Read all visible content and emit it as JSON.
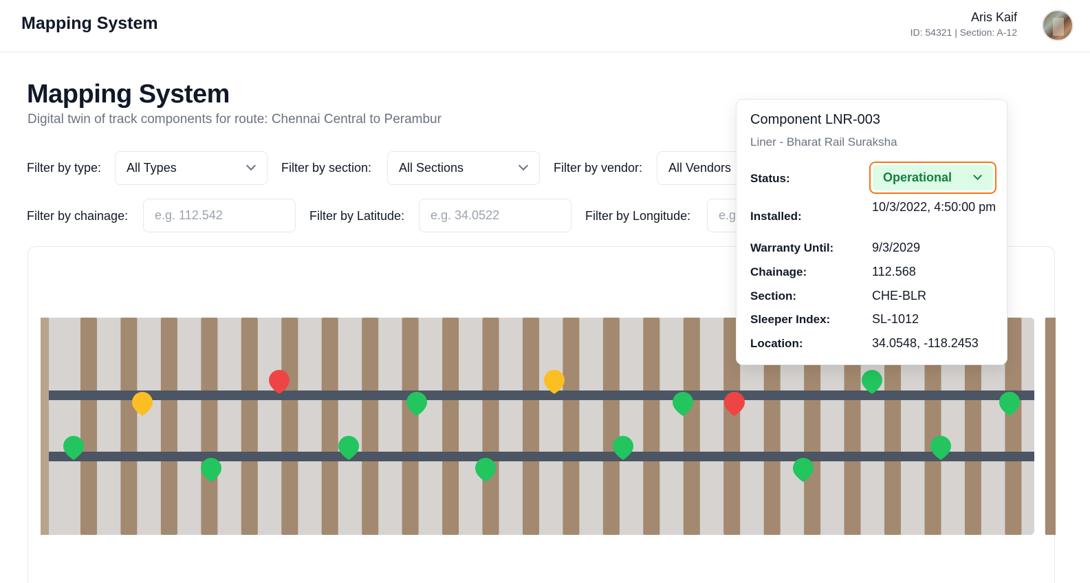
{
  "header": {
    "brand": "Mapping System",
    "user_name": "Aris Kaif",
    "user_meta": "ID: 54321 | Section: A-12"
  },
  "page": {
    "title": "Mapping System",
    "subtitle": "Digital twin of track components for route: Chennai Central to Perambur"
  },
  "filters": {
    "type_label": "Filter by type:",
    "type_value": "All Types",
    "section_label": "Filter by section:",
    "section_value": "All Sections",
    "vendor_label": "Filter by vendor:",
    "vendor_value": "All Vendors",
    "chainage_label": "Filter by chainage:",
    "chainage_placeholder": "e.g. 112.542",
    "latitude_label": "Filter by Latitude:",
    "latitude_placeholder": "e.g. 34.0522",
    "longitude_label": "Filter by Longitude:",
    "longitude_placeholder": "e.g. 118.2437"
  },
  "popup": {
    "title": "Component LNR-003",
    "subtitle": "Liner - Bharat Rail Suraksha",
    "status_label": "Status:",
    "status_value": "Operational",
    "installed_label": "Installed:",
    "installed_value": "10/3/2022, 4:50:00 pm",
    "warranty_label": "Warranty Until:",
    "warranty_value": "9/3/2029",
    "chainage_label": "Chainage:",
    "chainage_value": "112.568",
    "section_label": "Section:",
    "section_value": "CHE-BLR",
    "sleeper_label": "Sleeper Index:",
    "sleeper_value": "SL-1012",
    "location_label": "Location:",
    "location_value": "34.0548, -118.2453"
  },
  "track": {
    "sleeper_count": 25,
    "colors": {
      "ballast": "#d6d3d1",
      "sleeper": "#a3896f",
      "rail": "#4b5563",
      "operational": "#22c55e",
      "warning": "#fbbf24",
      "fault": "#ef4444"
    },
    "markers": [
      {
        "status": "operational"
      },
      {
        "status": "warning"
      },
      {
        "status": "operational"
      },
      {
        "status": "fault"
      },
      {
        "status": "operational"
      },
      {
        "status": "operational"
      },
      {
        "status": "operational"
      },
      {
        "status": "warning"
      },
      {
        "status": "operational"
      },
      {
        "status": "operational"
      },
      {
        "status": "fault"
      },
      {
        "status": "operational"
      },
      {
        "status": "operational"
      },
      {
        "status": "operational"
      },
      {
        "status": "warning"
      },
      {
        "status": "operational"
      }
    ]
  }
}
